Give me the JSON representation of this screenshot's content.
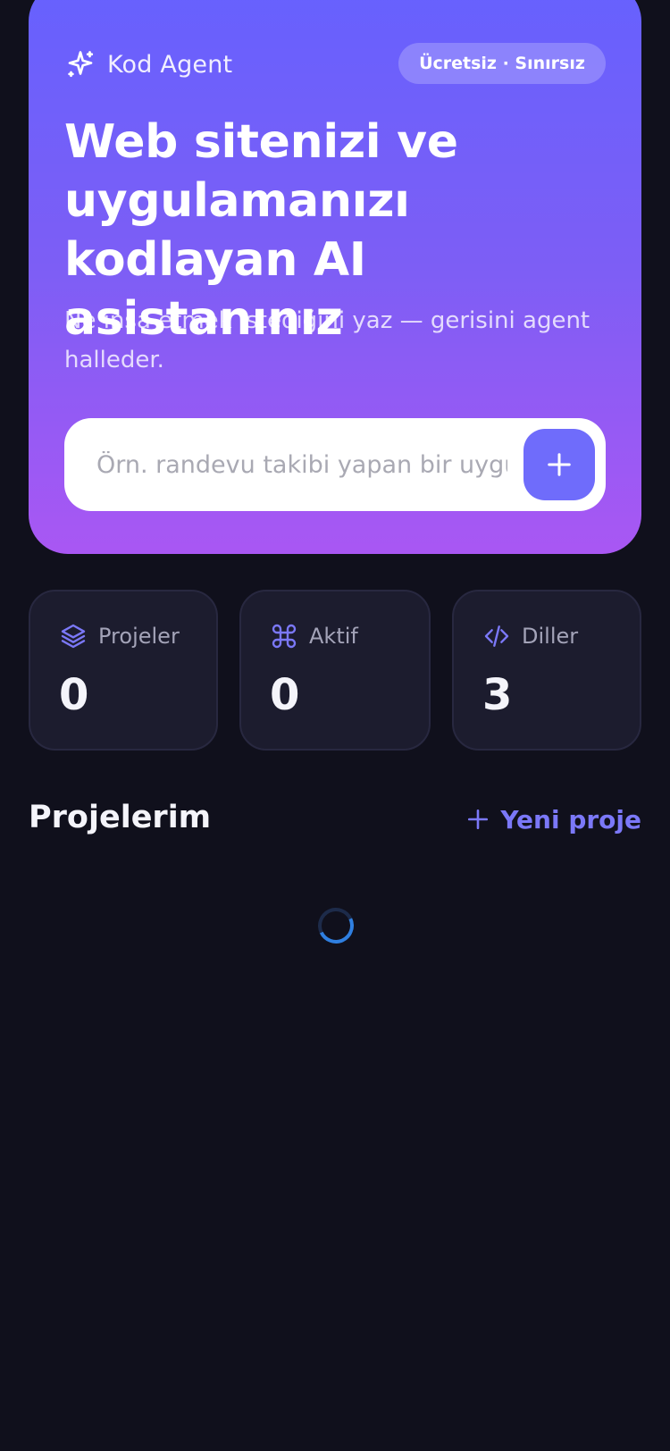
{
  "hero": {
    "brand_name": "Kod Agent",
    "badge": "Ücretsiz · Sınırsız",
    "headline": "Web sitenizi ve uygulamanızı kodlayan AI asistanınız",
    "subtitle": "Ne inşa etmek istediğini yaz — gerisini agent halleder.",
    "prompt": {
      "placeholder": "Örn. randevu takibi yapan bir uygu",
      "value": ""
    }
  },
  "stats": [
    {
      "label": "Projeler",
      "value": "0",
      "icon": "layers-icon"
    },
    {
      "label": "Aktif",
      "value": "0",
      "icon": "command-icon"
    },
    {
      "label": "Diller",
      "value": "3",
      "icon": "code-icon"
    }
  ],
  "projects": {
    "title": "Projelerim",
    "new_label": "Yeni proje",
    "loading": true
  },
  "colors": {
    "background": "#10101c",
    "hero_gradient_top": "#6661fe",
    "hero_gradient_bottom": "#a957f3",
    "accent": "#7b78f8",
    "card": "#1c1c2e",
    "spinner": "#2f7fe0"
  }
}
